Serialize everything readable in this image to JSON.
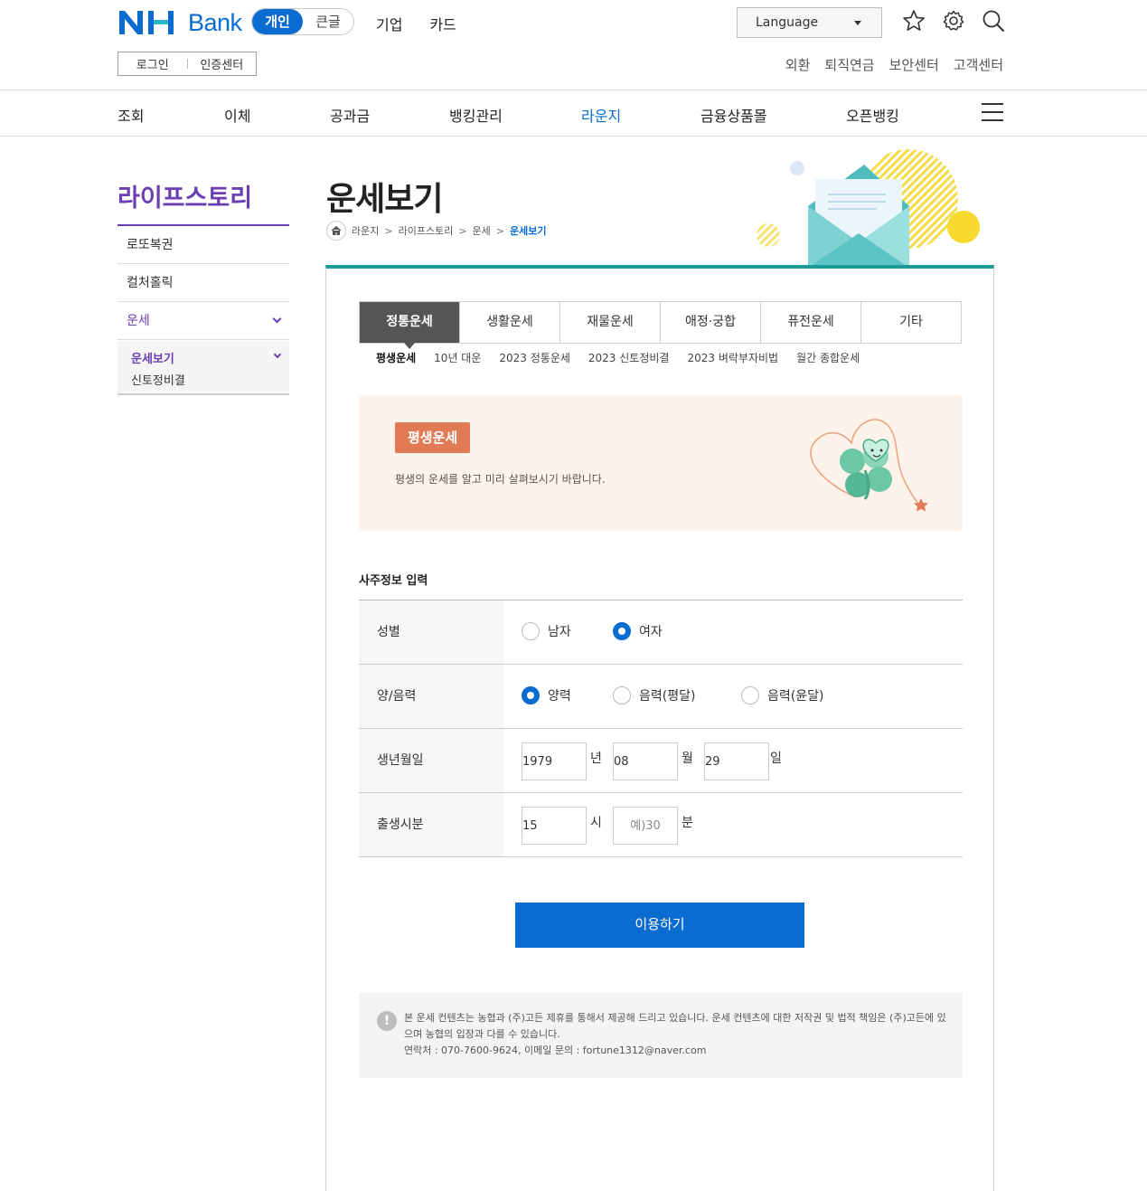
{
  "brand": {
    "bank_label": "Bank",
    "accent": "#0a6bd1",
    "purple": "#6a3fb2",
    "teal": "#1a9a98"
  },
  "header": {
    "segments": [
      {
        "label": "개인",
        "active": true
      },
      {
        "label": "큰글",
        "active": false
      }
    ],
    "top_nav": [
      "기업",
      "카드"
    ],
    "language": "Language",
    "auth": {
      "login": "로그인",
      "cert": "인증센터"
    },
    "util": [
      "외환",
      "퇴직연금",
      "보안센터",
      "고객센터"
    ]
  },
  "gnb": [
    "조회",
    "이체",
    "공과금",
    "뱅킹관리",
    "라운지",
    "금융상품몰",
    "오픈뱅킹"
  ],
  "lnb": {
    "title": "라이프스토리",
    "items": [
      "로또복권",
      "컬처홀릭",
      "운세"
    ],
    "sub": [
      "운세보기",
      "신토정비결"
    ]
  },
  "page": {
    "title": "운세보기",
    "breadcrumb": [
      "라운지",
      "라이프스토리",
      "운세",
      "운세보기"
    ]
  },
  "tabs": [
    "정통운세",
    "생활운세",
    "재물운세",
    "애정·궁합",
    "퓨전운세",
    "기타"
  ],
  "subtabs": [
    "평생운세",
    "10년 대운",
    "2023 정통운세",
    "2023 신토정비결",
    "2023 벼락부자비법",
    "월간 종합운세"
  ],
  "banner": {
    "badge": "평생운세",
    "desc": "평생의 운세를 알고 미리 살펴보시기 바랍니다."
  },
  "form": {
    "title": "사주정보 입력",
    "gender": {
      "label": "성별",
      "options": [
        "남자",
        "여자"
      ],
      "selected": "여자"
    },
    "calendar": {
      "label": "양/음력",
      "options": [
        "양력",
        "음력(평달)",
        "음력(윤달)"
      ],
      "selected": "양력"
    },
    "birth": {
      "label": "생년월일",
      "year": "1979",
      "year_unit": "년",
      "month": "08",
      "month_unit": "월",
      "day": "29",
      "day_unit": "일"
    },
    "time": {
      "label": "출생시분",
      "hour": "15",
      "hour_unit": "시",
      "minute_placeholder": "예)30",
      "minute_unit": "분"
    }
  },
  "submit_label": "이용하기",
  "notice": {
    "line1": "본 운세 컨텐츠는 농협과 (주)고든 제휴를 통해서 제공해 드리고 있습니다. 운세 컨텐츠에 대한 저작권 및 법적 책임은 (주)고든에 있으며 농협의 입장과 다를 수 있습니다.",
    "line2": "연락처 : 070-7600-9624, 이메일 문의 : fortune1312@naver.com"
  }
}
